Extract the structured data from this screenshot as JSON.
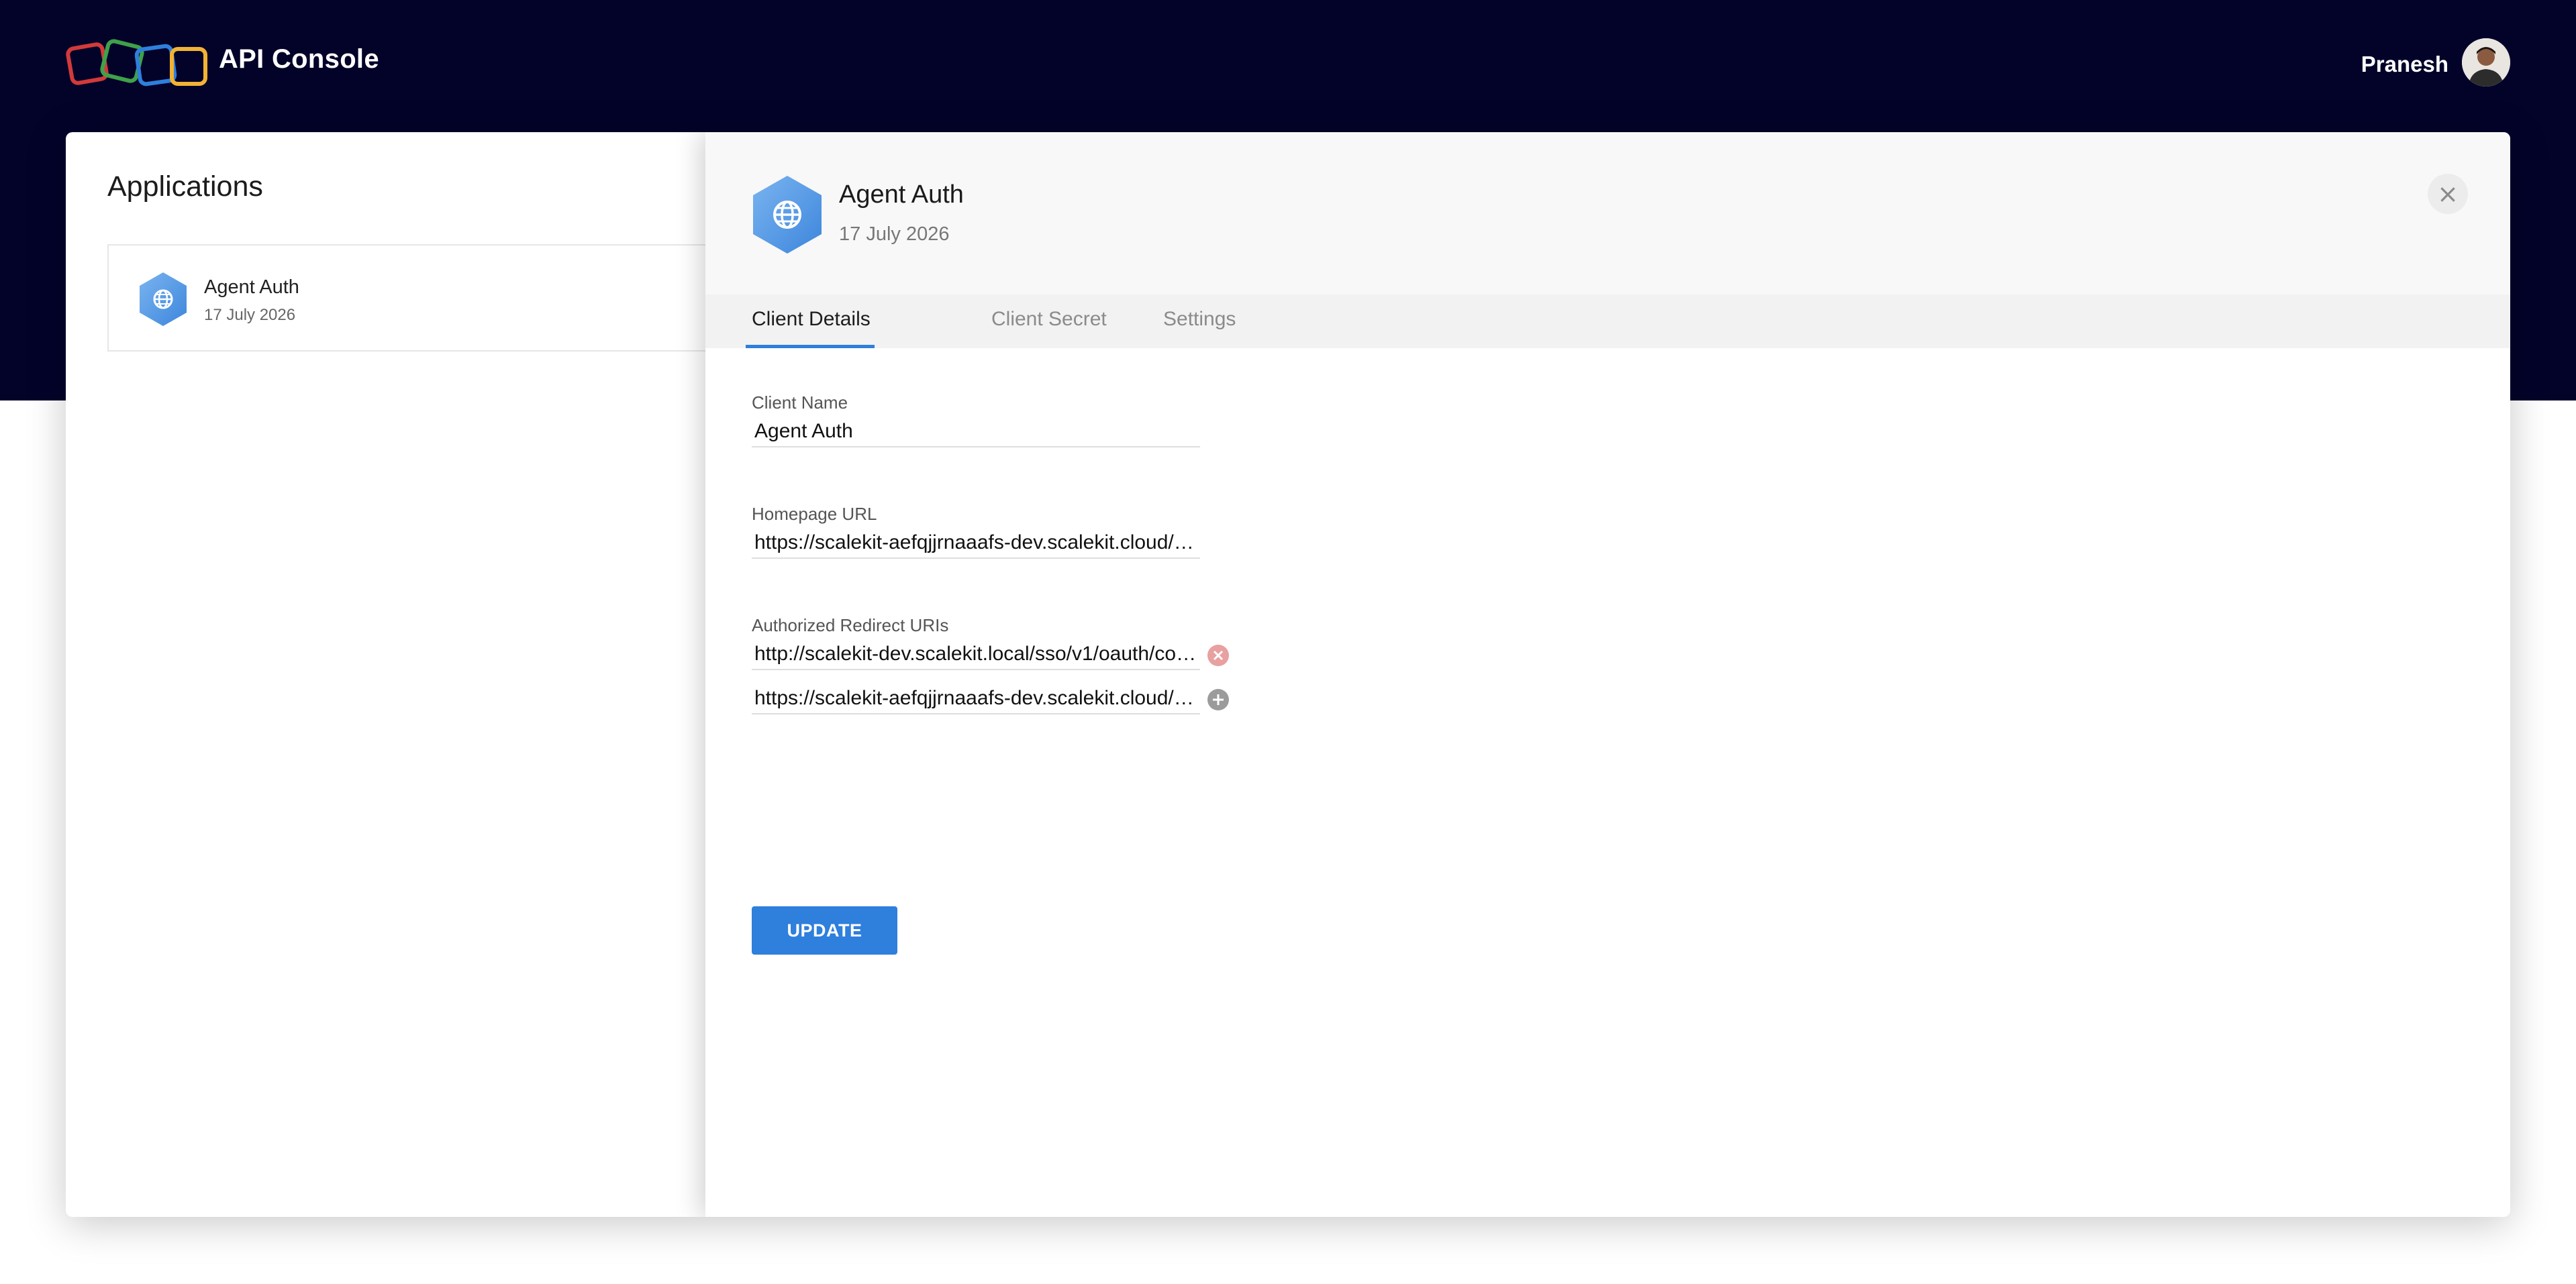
{
  "header": {
    "brand": "API Console",
    "user_name": "Pranesh"
  },
  "applications": {
    "title": "Applications",
    "items": [
      {
        "name": "Agent Auth",
        "date": "17 July 2026"
      }
    ]
  },
  "detail": {
    "title": "Agent Auth",
    "date": "17 July 2026",
    "tabs": [
      {
        "label": "Client Details",
        "active": true
      },
      {
        "label": "Client Secret",
        "active": false
      },
      {
        "label": "Settings",
        "active": false
      }
    ],
    "fields": {
      "client_name_label": "Client Name",
      "client_name_value": "Agent Auth",
      "homepage_label": "Homepage URL",
      "homepage_value": "https://scalekit-aefqjjrnaaafs-dev.scalekit.cloud/…",
      "redirect_label": "Authorized Redirect URIs",
      "redirect_uris": [
        "http://scalekit-dev.scalekit.local/sso/v1/oauth/co…",
        "https://scalekit-aefqjjrnaaafs-dev.scalekit.cloud/…"
      ]
    },
    "update_label": "UPDATE"
  },
  "colors": {
    "header_bg": "#03032a",
    "accent": "#2f7fdc",
    "remove": "#e8a0a0",
    "add": "#9b9b9b"
  },
  "icons": [
    "logo-icon",
    "avatar",
    "globe-icon",
    "close-icon",
    "remove-icon",
    "add-icon"
  ]
}
